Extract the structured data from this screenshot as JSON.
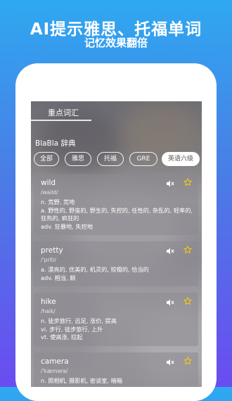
{
  "banner": {
    "headline": "AI提示雅思、托福单词",
    "subline": "记忆效果翻倍"
  },
  "tabs": [
    {
      "label": "重点词汇"
    }
  ],
  "dictionary_title": "BlaBla 辞典",
  "filters": [
    {
      "label": "全部",
      "selected": false
    },
    {
      "label": "雅思",
      "selected": false
    },
    {
      "label": "托福",
      "selected": false
    },
    {
      "label": "GRE",
      "selected": false
    },
    {
      "label": "英语六级",
      "selected": true
    }
  ],
  "words": [
    {
      "word": "wild",
      "phonetic": "/waild/",
      "defs": [
        "n. 荒野, 荒地",
        "a. 野性的, 野蛮的, 野生的, 失控的, 任性的, 杂乱的, 轻率的,",
        "狂热的, 疯狂的",
        "adv. 狂暴地, 失控地"
      ]
    },
    {
      "word": "pretty",
      "phonetic": "/'priti/",
      "defs": [
        "a. 漂亮的, 优美的, 机灵的, 狡猾的, 恰当的",
        "adv. 相当, 颇"
      ]
    },
    {
      "word": "hike",
      "phonetic": "/haik/",
      "defs": [
        "n. 徒步旅行, 远足, 涨价, 提高",
        "vi. 步行, 徒步旅行, 上升",
        "vt. 使高涨, 拉起"
      ]
    },
    {
      "word": "camera",
      "phonetic": "/'kæmərə/",
      "defs": [
        "n. 照相机, 摄影机, 密谈室, 暗箱"
      ]
    }
  ],
  "colors": {
    "gradient_top": "#2fa8f0",
    "gradient_bottom": "#6a4cf0",
    "star": "#f5c518"
  },
  "icons": [
    "speaker-muted-icon",
    "star-icon"
  ]
}
